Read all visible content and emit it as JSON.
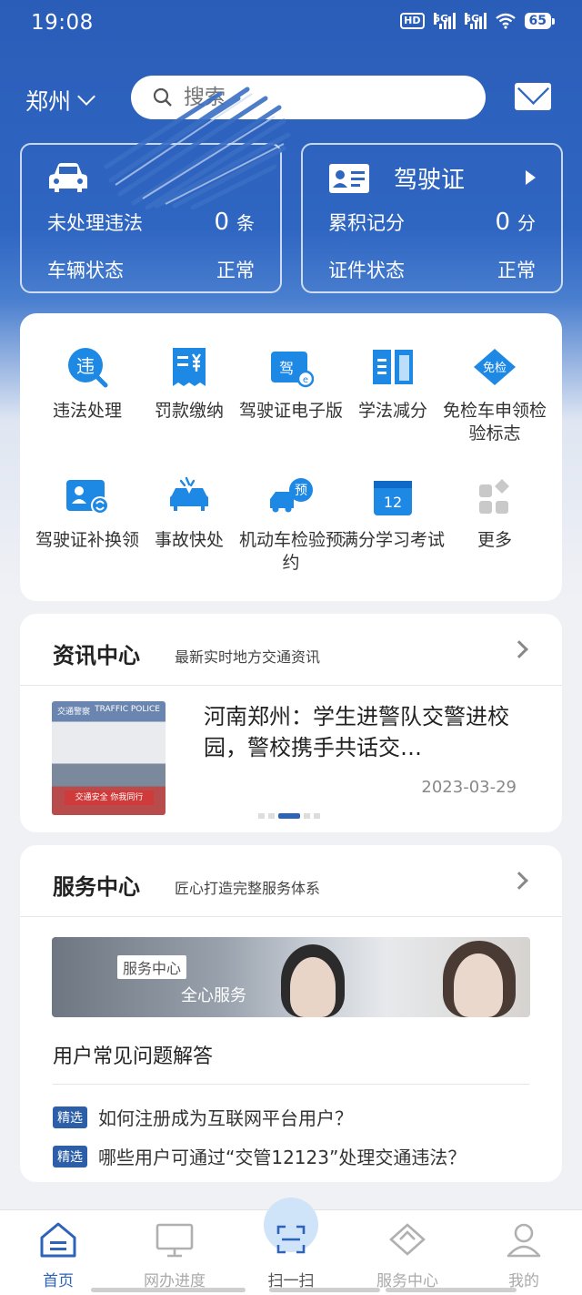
{
  "status_bar": {
    "time": "19:08",
    "hd_label": "HD",
    "sig1": "5G",
    "sig2": "5G",
    "battery": "65"
  },
  "header": {
    "city": "郑州",
    "search_placeholder": "搜索"
  },
  "vehicle_card": {
    "title": "",
    "violation_label": "未处理违法",
    "violation_value": "0",
    "violation_unit": "条",
    "status_label": "车辆状态",
    "status_value": "正常"
  },
  "license_card": {
    "title": "驾驶证",
    "points_label": "累积记分",
    "points_value": "0",
    "points_unit": "分",
    "status_label": "证件状态",
    "status_value": "正常"
  },
  "services": [
    {
      "label": "违法处理",
      "icon": "violation-icon",
      "badge": "违"
    },
    {
      "label": "罚款缴纳",
      "icon": "fine-receipt-icon",
      "badge": ""
    },
    {
      "label": "驾驶证电子版",
      "icon": "e-license-icon",
      "badge": "驾"
    },
    {
      "label": "学法减分",
      "icon": "book-icon",
      "badge": ""
    },
    {
      "label": "免检车申领检验标志",
      "icon": "exempt-icon",
      "badge": "免检"
    },
    {
      "label": "驾驶证补换领",
      "icon": "license-replace-icon",
      "badge": ""
    },
    {
      "label": "事故快处",
      "icon": "accident-icon",
      "badge": ""
    },
    {
      "label": "机动车检验预约",
      "icon": "inspection-booking-icon",
      "badge": "预"
    },
    {
      "label": "满分学习考试",
      "icon": "calendar-icon",
      "badge": "12"
    },
    {
      "label": "更多",
      "icon": "more-icon",
      "badge": ""
    }
  ],
  "news": {
    "title": "资讯中心",
    "subtitle": "最新实时地方交通资讯",
    "headline": "河南郑州：学生进警队交警进校园，警校携手共话交…",
    "date": "2023-03-29",
    "image_top_left": "交通警察",
    "image_top_right": "TRAFFIC POLICE",
    "image_banner": "交通安全 你我同行"
  },
  "service_center": {
    "title": "服务中心",
    "subtitle": "匠心打造完整服务体系",
    "banner_tag": "服务中心",
    "banner_text": "全心服务",
    "faq_title": "用户常见问题解答",
    "faq_tag": "精选",
    "faqs": [
      "如何注册成为互联网平台用户？",
      "哪些用户可通过“交管12123”处理交通违法？"
    ]
  },
  "bottom_nav": [
    {
      "label": "首页",
      "icon": "home-icon",
      "active": true
    },
    {
      "label": "网办进度",
      "icon": "monitor-icon",
      "active": false
    },
    {
      "label": "扫一扫",
      "icon": "scan-icon",
      "active": false
    },
    {
      "label": "服务中心",
      "icon": "diamond-icon",
      "active": false
    },
    {
      "label": "我的",
      "icon": "user-icon",
      "active": false
    }
  ],
  "colors": {
    "primary": "#2f66c2",
    "accent": "#1e88e5",
    "tag": "#2d5fa8"
  }
}
